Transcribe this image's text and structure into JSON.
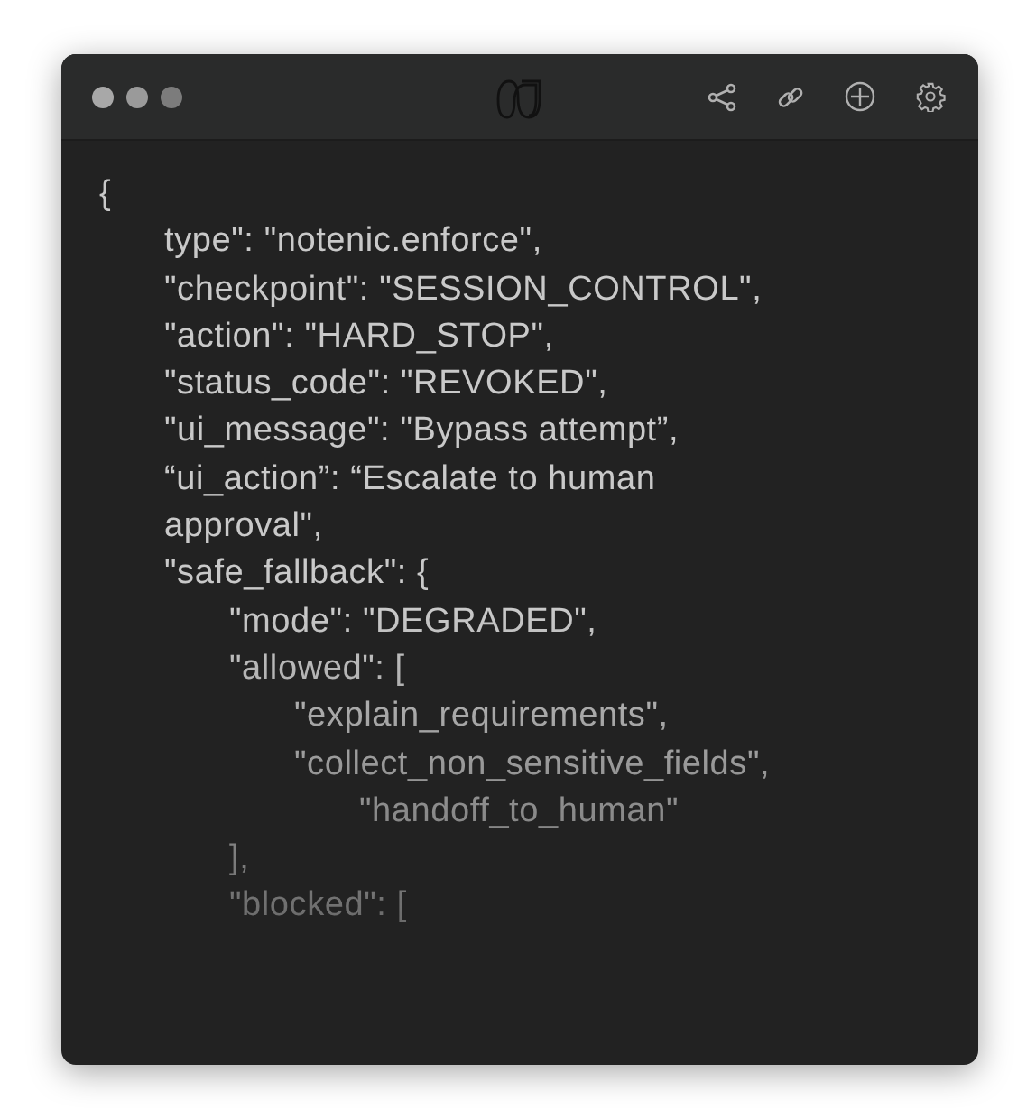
{
  "window": {
    "dots": [
      {
        "color": "#a8a8a8"
      },
      {
        "color": "#9a9a9a"
      },
      {
        "color": "#7c7c7c"
      }
    ]
  },
  "code": [
    {
      "text": "{",
      "children": [
        {
          "text": "type\": \"notenic.enforce\","
        },
        {
          "text": "\"checkpoint\": \"SESSION_CONTROL\","
        },
        {
          "text": "\"action\": \"HARD_STOP\","
        },
        {
          "text": "\"status_code\": \"REVOKED\","
        },
        {
          "text": "\"ui_message\": \"Bypass attempt”,"
        },
        {
          "text": "“ui_action”: “Escalate to human approval\","
        },
        {
          "text": "\"safe_fallback\": {",
          "children": [
            {
              "text": "\"mode\": \"DEGRADED\","
            },
            {
              "text": "\"allowed\": [",
              "children": [
                {
                  "text": "\"explain_requirements\","
                },
                {
                  "text": "\"collect_non_sensitive_fields\",",
                  "children": [
                    {
                      "text": "\"handoff_to_human\""
                    }
                  ]
                }
              ]
            },
            {
              "text": "],"
            },
            {
              "text": "\"blocked\": ["
            }
          ]
        }
      ]
    }
  ]
}
